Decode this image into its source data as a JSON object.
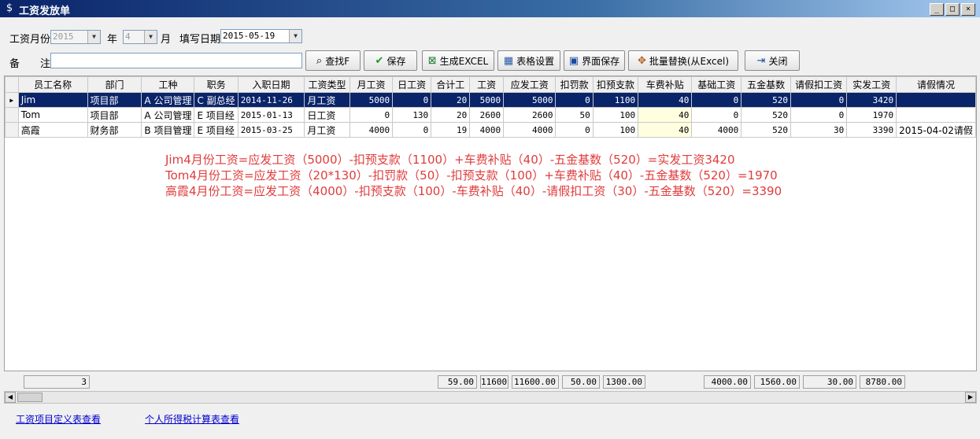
{
  "window": {
    "title": "工资发放单",
    "buttons": {
      "min": "_",
      "max": "□",
      "close": "×"
    }
  },
  "form": {
    "month_label": "工资月份",
    "year_value": "2015",
    "year_label": "年",
    "month_value": "4",
    "month_unit": "月",
    "date_label": "填写日期",
    "date_value": "2015-05-19",
    "remark_label": "备　　注",
    "remark_value": ""
  },
  "toolbar": [
    {
      "icon": "binoculars-icon",
      "glyph": "⌕",
      "label": "查找F"
    },
    {
      "icon": "checkmark-icon",
      "glyph": "✔",
      "label": "保存"
    },
    {
      "icon": "excel-icon",
      "glyph": "⊠",
      "label": "生成EXCEL"
    },
    {
      "icon": "table-settings-icon",
      "glyph": "▦",
      "label": "表格设置"
    },
    {
      "icon": "floppy-disk-icon",
      "glyph": "▣",
      "label": "界面保存"
    },
    {
      "icon": "batch-replace-icon",
      "glyph": "✥",
      "label": "批量替换(从Excel)"
    },
    {
      "icon": "exit-door-icon",
      "glyph": "⇥",
      "label": "关闭"
    }
  ],
  "columns": [
    "员工名称",
    "部门",
    "工种",
    "职务",
    "入职日期",
    "工资类型",
    "月工资",
    "日工资",
    "合计工",
    "工资",
    "应发工资",
    "扣罚款",
    "扣预支款",
    "车费补贴",
    "基础工资",
    "五金基数",
    "请假扣工资",
    "实发工资",
    "请假情况"
  ],
  "rows": [
    [
      "Jim",
      "项目部",
      "A 公司管理",
      "C 副总经",
      "2014-11-26",
      "月工资",
      "5000",
      "0",
      "20",
      "5000",
      "5000",
      "0",
      "1100",
      "40",
      "0",
      "520",
      "0",
      "3420",
      ""
    ],
    [
      "Tom",
      "项目部",
      "A 公司管理",
      "E 项目经",
      "2015-01-13",
      "日工资",
      "0",
      "130",
      "20",
      "2600",
      "2600",
      "50",
      "100",
      "40",
      "0",
      "520",
      "0",
      "1970",
      ""
    ],
    [
      "高霞",
      "财务部",
      "B 项目管理",
      "E 项目经",
      "2015-03-25",
      "月工资",
      "4000",
      "0",
      "19",
      "4000",
      "4000",
      "0",
      "100",
      "40",
      "4000",
      "520",
      "30",
      "3390",
      "2015-04-02请假"
    ]
  ],
  "selected_row": 0,
  "notes": [
    "Jim4月份工资=应发工资（5000）-扣预支款（1100）+车费补贴（40）-五金基数（520）=实发工资3420",
    "Tom4月份工资=应发工资（20*130）-扣罚款（50）-扣预支款（100）+车费补贴（40）-五金基数（520）=1970",
    "高霞4月份工资=应发工资（4000）-扣预支款（100）-车费补贴（40）-请假扣工资（30）-五金基数（520）=3390"
  ],
  "footer": {
    "count": "3",
    "total_days": "59.00",
    "total_wage": "11600",
    "total_payable": "11600.00",
    "total_fine": "50.00",
    "total_advance": "1300.00",
    "total_base": "4000.00",
    "total_insurance": "1560.00",
    "total_leave": "30.00",
    "total_actual": "8780.00"
  },
  "links": [
    "工资项目定义表查看",
    "个人所得税计算表查看"
  ]
}
